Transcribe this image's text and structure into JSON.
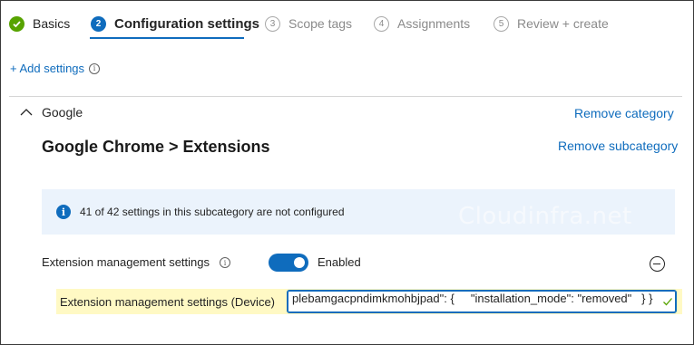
{
  "wizard": {
    "steps": [
      {
        "number": "",
        "label": "Basics",
        "state": "done"
      },
      {
        "number": "2",
        "label": "Configuration settings",
        "state": "active"
      },
      {
        "number": "3",
        "label": "Scope tags",
        "state": "todo"
      },
      {
        "number": "4",
        "label": "Assignments",
        "state": "todo"
      },
      {
        "number": "5",
        "label": "Review + create",
        "state": "todo"
      }
    ]
  },
  "add_settings": {
    "label": "+ Add settings"
  },
  "category": {
    "name": "Google",
    "remove_label": "Remove category"
  },
  "subcategory": {
    "title": "Google Chrome > Extensions",
    "remove_label": "Remove subcategory"
  },
  "info_message": "41 of 42 settings in this subcategory are not configured",
  "watermark": "Cloudinfra.net",
  "setting": {
    "label": "Extension management settings",
    "toggle_label": "Enabled",
    "enabled": true
  },
  "device_setting": {
    "label": "Extension management settings (Device)",
    "value": "plebamgacpndimkmohbjpad\": {     \"installation_mode\": \"removed\"   } }"
  },
  "colors": {
    "accent": "#0f6cbd",
    "done": "#57a300",
    "highlight": "#fff9c4",
    "info_bg": "#ebf3fc"
  }
}
